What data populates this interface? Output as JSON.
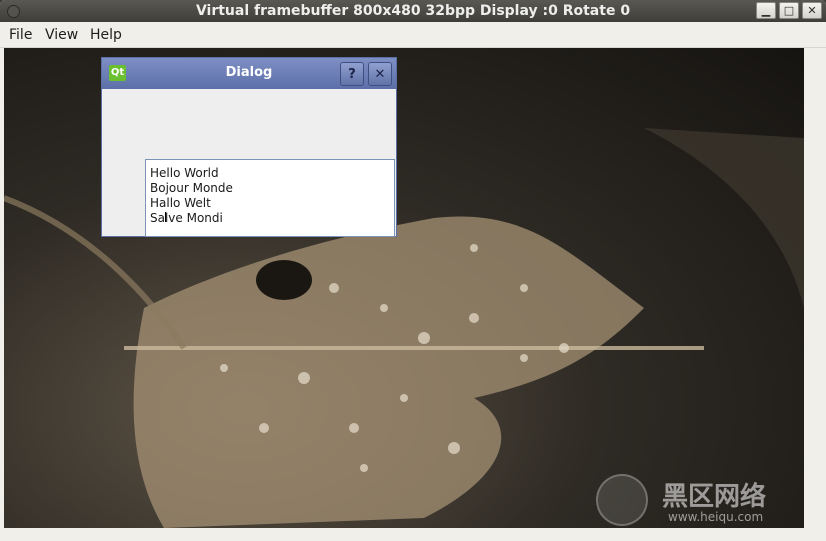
{
  "window": {
    "title": "Virtual framebuffer 800x480 32bpp Display :0 Rotate 0"
  },
  "menu": {
    "file": "File",
    "view": "View",
    "help": "Help"
  },
  "dialog": {
    "title": "Dialog",
    "help_label": "?",
    "close_label": "✕",
    "lines": [
      "Hello World",
      "Bojour Monde",
      "Hallo Welt",
      "Salve Mondi"
    ]
  },
  "watermark": {
    "cn": "黑区网络",
    "url": "www.heiqu.com"
  }
}
